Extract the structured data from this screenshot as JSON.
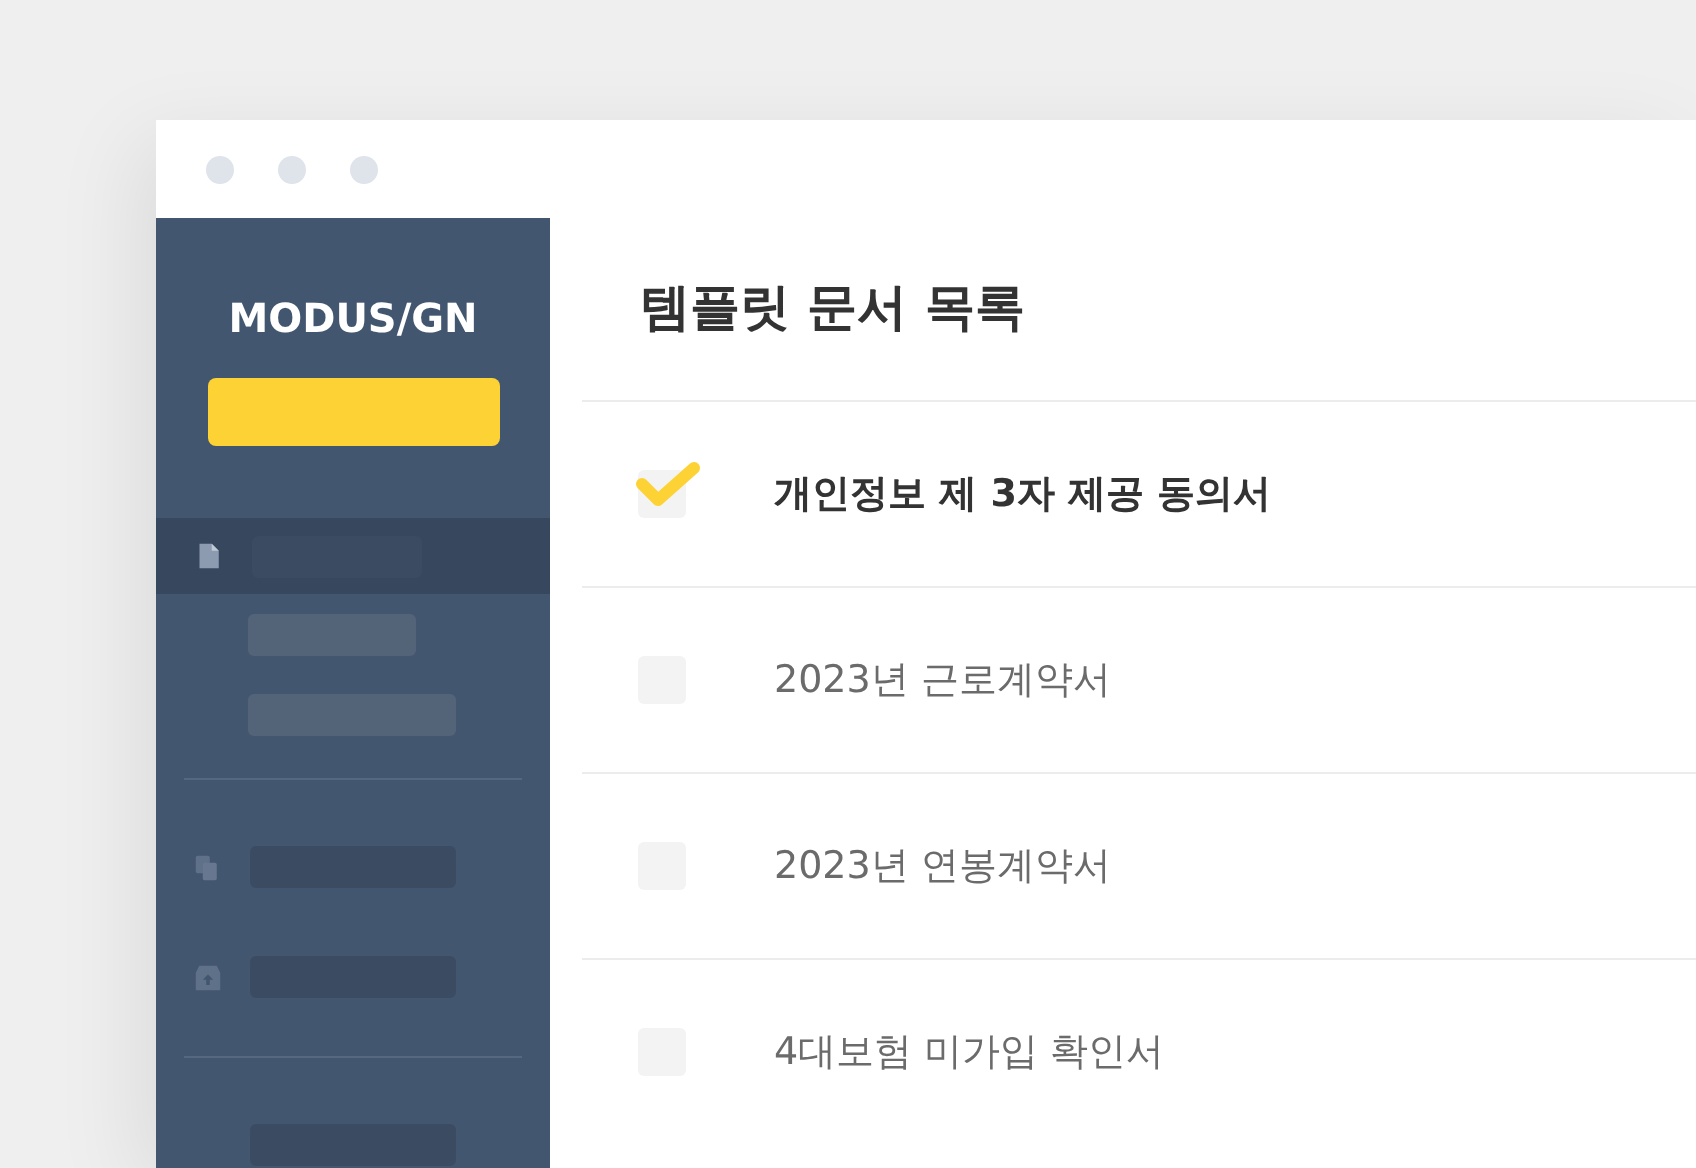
{
  "sidebar": {
    "logo": "MODUS/GN",
    "items": [
      {
        "kind": "file",
        "selected": true
      },
      {
        "kind": "sub",
        "selected": false
      },
      {
        "kind": "sub",
        "selected": false
      },
      {
        "kind": "divider"
      },
      {
        "kind": "copy",
        "selected": false
      },
      {
        "kind": "archive",
        "selected": false
      },
      {
        "kind": "divider"
      },
      {
        "kind": "partial",
        "selected": false
      }
    ]
  },
  "main": {
    "title": "템플릿 문서 목록",
    "documents": [
      {
        "name": "개인정보 제 3자 제공 동의서",
        "checked": true
      },
      {
        "name": "2023년 근로계약서",
        "checked": false
      },
      {
        "name": "2023년 연봉계약서",
        "checked": false
      },
      {
        "name": "4대보험 미가입 확인서",
        "checked": false
      }
    ]
  }
}
